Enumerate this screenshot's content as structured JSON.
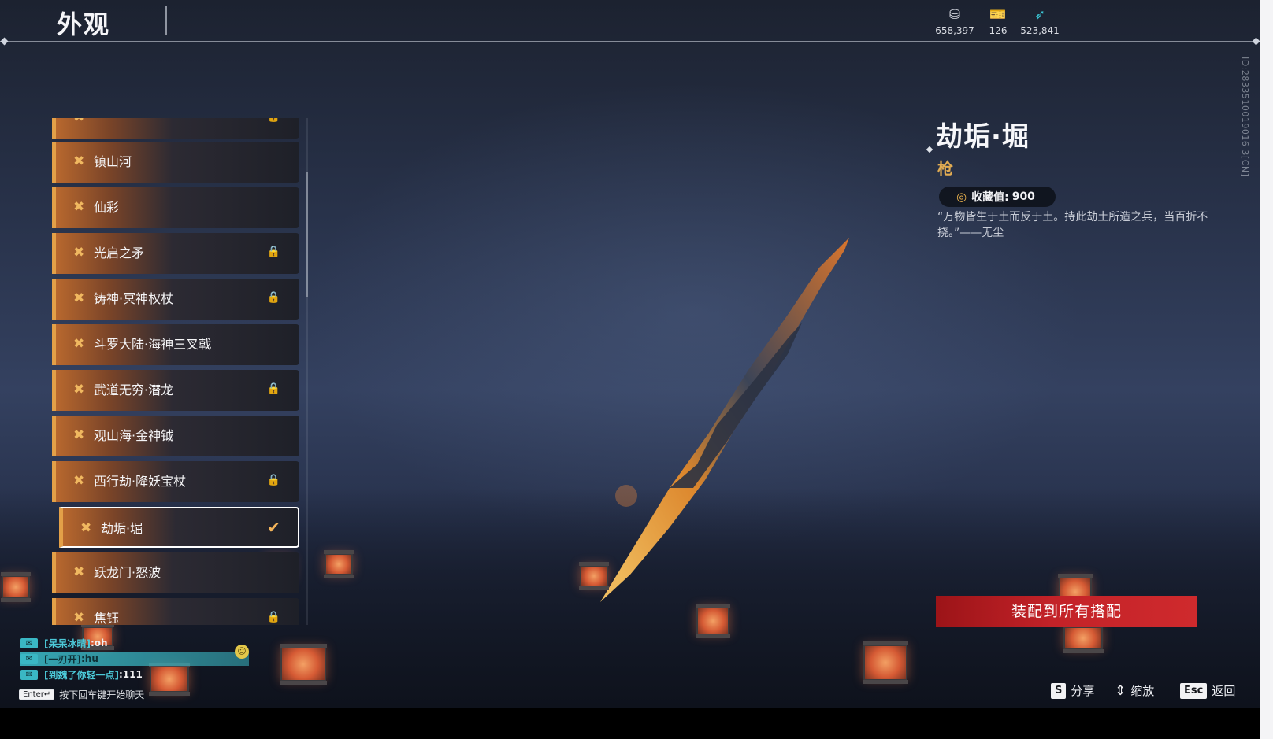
{
  "header": {
    "title": "外观",
    "currencies": [
      {
        "icon": "silver-coin-icon",
        "value": "658,397"
      },
      {
        "icon": "gold-ticket-icon",
        "value": "126"
      },
      {
        "icon": "feather-icon",
        "value": "523,841"
      }
    ],
    "server_id": "ID:2833510019016 3[CN]"
  },
  "list": {
    "items": [
      {
        "label": "镇山河",
        "locked": false
      },
      {
        "label": "仙彩",
        "locked": false
      },
      {
        "label": "光启之矛",
        "locked": true
      },
      {
        "label": "铸神·冥神权杖",
        "locked": true
      },
      {
        "label": "斗罗大陆·海神三叉戟",
        "locked": false
      },
      {
        "label": "武道无穷·潜龙",
        "locked": true
      },
      {
        "label": "观山海·金神钺",
        "locked": false
      },
      {
        "label": "西行劫·降妖宝杖",
        "locked": true
      },
      {
        "label": "劫垢·堀",
        "locked": false,
        "selected": true
      },
      {
        "label": "跃龙门·怒波",
        "locked": false
      },
      {
        "label": "焦钰",
        "locked": true
      }
    ]
  },
  "detail": {
    "name": "劫垢·堀",
    "type": "枪",
    "collect_label": "收藏值:",
    "collect_value": "900",
    "quote": "“万物皆生于土而反于土。持此劫土所造之兵，当百折不挠。”——无尘",
    "equip_all_label": "装配到所有搭配"
  },
  "hints": {
    "share_key": "S",
    "share_label": "分享",
    "zoom_label": "缩放",
    "back_key": "Esc",
    "back_label": "返回"
  },
  "chat": {
    "lines": [
      {
        "name": "[呆呆冰晴]",
        "msg": ":oh"
      },
      {
        "name": "[一刃开]",
        "msg": ":hu"
      },
      {
        "name": "[到魏了你轻一点]",
        "msg": ":111"
      }
    ],
    "enter_key": "Enter↵",
    "enter_hint": "按下回车键开始聊天"
  },
  "colors": {
    "accent_orange": "#e3a048",
    "equip_red": "#c32228",
    "chat_cyan": "#3ab7c4"
  }
}
